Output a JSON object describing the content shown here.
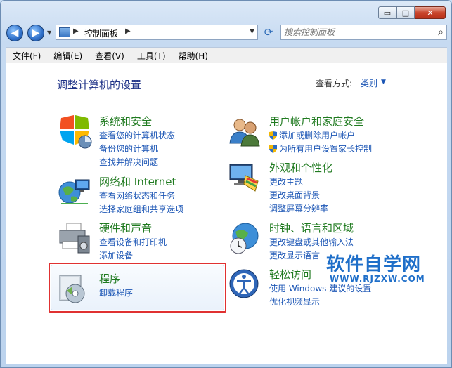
{
  "window": {
    "buttons": {
      "minimize": "▭",
      "maximize": "□",
      "close": "✕"
    }
  },
  "nav": {
    "back": "◀",
    "forward": "▶",
    "breadcrumb": "控制面板",
    "search_placeholder": "搜索控制面板"
  },
  "menu": [
    "文件(F)",
    "编辑(E)",
    "查看(V)",
    "工具(T)",
    "帮助(H)"
  ],
  "page": {
    "title": "调整计算机的设置",
    "view_by_label": "查看方式:",
    "view_by_value": "类别"
  },
  "categories": [
    {
      "title": "系统和安全",
      "icon": "shield-system-icon",
      "links": [
        "查看您的计算机状态",
        "备份您的计算机",
        "查找并解决问题"
      ]
    },
    {
      "title": "网络和 Internet",
      "icon": "network-globe-icon",
      "links": [
        "查看网络状态和任务",
        "选择家庭组和共享选项"
      ]
    },
    {
      "title": "硬件和声音",
      "icon": "printer-icon",
      "links": [
        "查看设备和打印机",
        "添加设备"
      ]
    },
    {
      "title": "程序",
      "icon": "program-disc-icon",
      "links": [
        "卸载程序"
      ]
    },
    {
      "title": "用户帐户和家庭安全",
      "icon": "users-icon",
      "links": [
        "添加或删除用户帐户",
        "为所有用户设置家长控制"
      ]
    },
    {
      "title": "外观和个性化",
      "icon": "monitor-palette-icon",
      "links": [
        "更改主题",
        "更改桌面背景",
        "调整屏幕分辨率"
      ]
    },
    {
      "title": "时钟、语言和区域",
      "icon": "clock-globe-icon",
      "links": [
        "更改键盘或其他输入法",
        "更改显示语言"
      ]
    },
    {
      "title": "轻松访问",
      "icon": "ease-of-access-icon",
      "links": [
        "使用 Windows 建议的设置",
        "优化视频显示"
      ]
    }
  ],
  "watermark": {
    "text": "软件自学网",
    "url": "WWW.RJZXW.COM"
  },
  "colors": {
    "link": "#1c56b5",
    "category_title": "#1f7a1f",
    "highlight": "#e03131"
  }
}
